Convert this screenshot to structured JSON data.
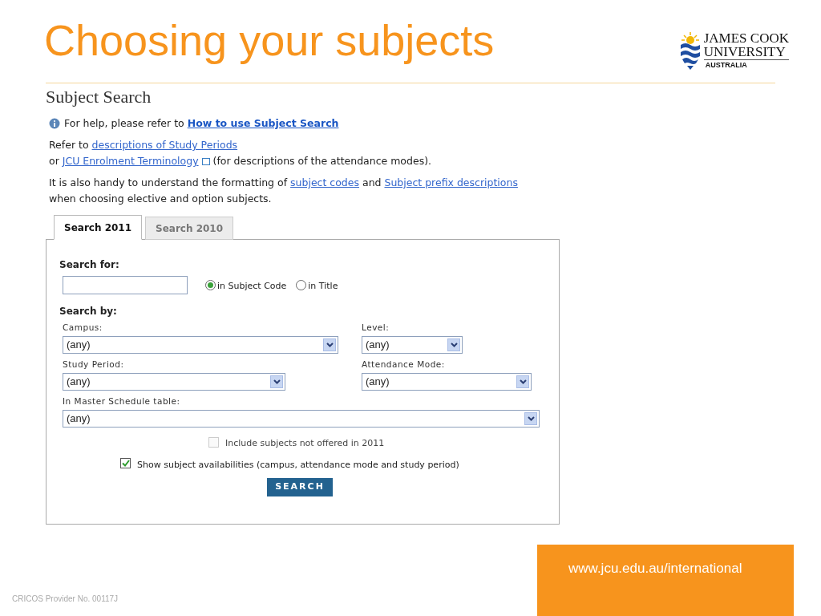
{
  "slide_title": "Choosing your subjects",
  "logo": {
    "line_1": "JAMES COOK",
    "line_2": "UNIVERSITY",
    "line_3": "AUSTRALIA"
  },
  "page_heading": "Subject Search",
  "paragraphs": [
    {
      "kind": "help",
      "parts": [
        {
          "kind": "text",
          "text": "For help, please refer to "
        },
        {
          "kind": "strong-link",
          "text": "How to use Subject Search"
        }
      ]
    },
    {
      "kind": "plain",
      "parts": [
        {
          "kind": "text",
          "text": "Refer to "
        },
        {
          "kind": "link",
          "text": "descriptions of Study Periods"
        },
        {
          "kind": "break"
        },
        {
          "kind": "text",
          "text": "or "
        },
        {
          "kind": "external-link",
          "text": "JCU Enrolment Terminology"
        },
        {
          "kind": "text",
          "text": " (for descriptions of the attendance modes)."
        }
      ]
    },
    {
      "kind": "plain",
      "parts": [
        {
          "kind": "text",
          "text": "It is also handy to understand the formatting of "
        },
        {
          "kind": "link",
          "text": "subject codes"
        },
        {
          "kind": "text",
          "text": " and "
        },
        {
          "kind": "link",
          "text": "Subject prefix descriptions"
        },
        {
          "kind": "text",
          "text": " when choosing elective and option subjects."
        }
      ]
    }
  ],
  "tabs": [
    {
      "label": "Search 2011",
      "selected": true
    },
    {
      "label": "Search 2010",
      "selected": false
    }
  ],
  "search_for": {
    "label": "Search for:",
    "options": [
      {
        "label": "in Subject Code",
        "selected": true
      },
      {
        "label": "in Title",
        "selected": false
      }
    ]
  },
  "search_by": {
    "label": "Search by:"
  },
  "filters": [
    {
      "label": "Campus:",
      "value": "(any)"
    },
    {
      "label": "Level:",
      "value": "(any)"
    },
    {
      "label": "Study Period:",
      "value": "(any)"
    },
    {
      "label": "Attendance Mode:",
      "value": "(any)"
    },
    {
      "label": "In Master Schedule table:",
      "value": "(any)"
    }
  ],
  "checkboxes": [
    {
      "label": "Include subjects not offered in 2011",
      "checked": false,
      "disabled": true
    },
    {
      "label": "Show subject availabilities (campus, attendance mode and study period)",
      "checked": true,
      "disabled": false
    }
  ],
  "search_button": "SEARCH",
  "footer": {
    "url": "www.jcu.edu.au/international",
    "provider": "CRICOS Provider No. 00117J"
  }
}
